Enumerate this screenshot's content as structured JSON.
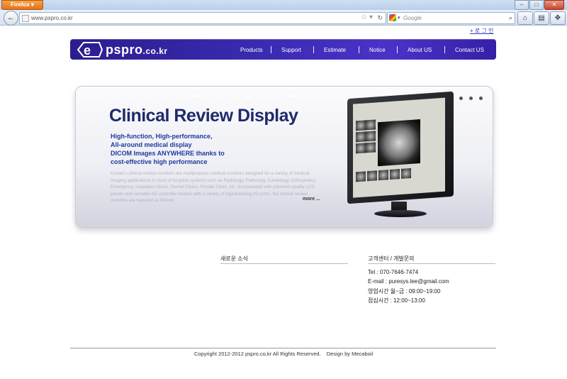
{
  "browser": {
    "app_button": "Firefox",
    "url": "www.pspro.co.kr",
    "search_placeholder": "Google"
  },
  "page": {
    "login_link": "+ 로 그 인",
    "logo": {
      "name": "pspro",
      "tld": ".co.kr"
    },
    "nav": [
      "Products",
      "Support",
      "Estimate",
      "Notice",
      "About US",
      "Contact US"
    ],
    "banner": {
      "title": "Clinical Review Display",
      "subtitle_lines": [
        "High-function, High-performance,",
        "All-around medical display",
        "DICOM Images ANYWHERE thanks to",
        "cost-effective high performance"
      ],
      "description": "Kostec's clinical review monitors are multipurpose medical monitors designed for a variety of medical imaging applications in most of hospital systems such as Radiology, Pathology, Cardiology, Orthopedics, Emergency, outpatient clinics, Dental Clinics, Private Clinis, etc. Incorporated with premium quality LCD panels and versatile AD controller boards with a variety of digital/analog I/O ports, the clinical review monitors are featured as follows:",
      "more": "more"
    },
    "news": {
      "title": "새로운 소식"
    },
    "customer_center": {
      "title": "고객센터 / 개발문의",
      "lines": [
        "Tel : 070-7646-7474",
        "E-mail : puresys.lee@gmail.com",
        "영업시간 월~금 : 09:00~19:00",
        "점심시간 : 12:00~13:00"
      ]
    },
    "footer": {
      "copyright": "Copyright 2012-2012 pspro.co.kr All Rights Reserved.",
      "design": "Design by Mecaboil"
    }
  },
  "colors": {
    "header_gradient_start": "#2a1d8e",
    "header_gradient_end": "#4a32c8",
    "banner_title": "#1f2a6b",
    "banner_subtitle": "#1f3a9c",
    "firefox_button": "#e2731b"
  }
}
